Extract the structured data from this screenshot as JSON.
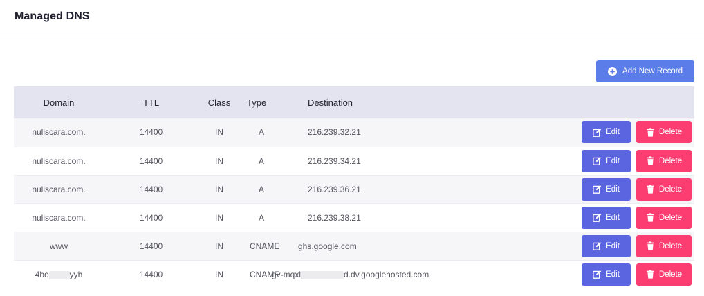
{
  "header": {
    "title": "Managed DNS"
  },
  "toolbar": {
    "add_label": "Add New Record"
  },
  "table": {
    "columns": [
      "Domain",
      "TTL",
      "Class",
      "Type",
      "Destination"
    ],
    "rows": [
      {
        "domain": "nuliscara.com.",
        "ttl": "14400",
        "class": "IN",
        "type": "A",
        "destination": "216.239.32.21"
      },
      {
        "domain": "nuliscara.com.",
        "ttl": "14400",
        "class": "IN",
        "type": "A",
        "destination": "216.239.34.21"
      },
      {
        "domain": "nuliscara.com.",
        "ttl": "14400",
        "class": "IN",
        "type": "A",
        "destination": "216.239.36.21"
      },
      {
        "domain": "nuliscara.com.",
        "ttl": "14400",
        "class": "IN",
        "type": "A",
        "destination": "216.239.38.21"
      },
      {
        "domain": "www",
        "ttl": "14400",
        "class": "IN",
        "type": "CNAME",
        "destination": "ghs.google.com"
      },
      {
        "domain_a": "4bo",
        "domain_b": "yyh",
        "ttl": "14400",
        "class": "IN",
        "type": "CNAME",
        "destination_a": "gv-mqxl",
        "destination_b": "d.dv.googlehosted.com"
      }
    ],
    "edit_label": "Edit",
    "delete_label": "Delete"
  },
  "colors": {
    "primary": "#5b7de9",
    "edit": "#5b65e0",
    "delete": "#fb3d72",
    "header_bg": "#e4e4f0"
  },
  "icons": {
    "add": "plus-circle-icon",
    "edit": "edit-icon",
    "delete": "trash-icon"
  }
}
